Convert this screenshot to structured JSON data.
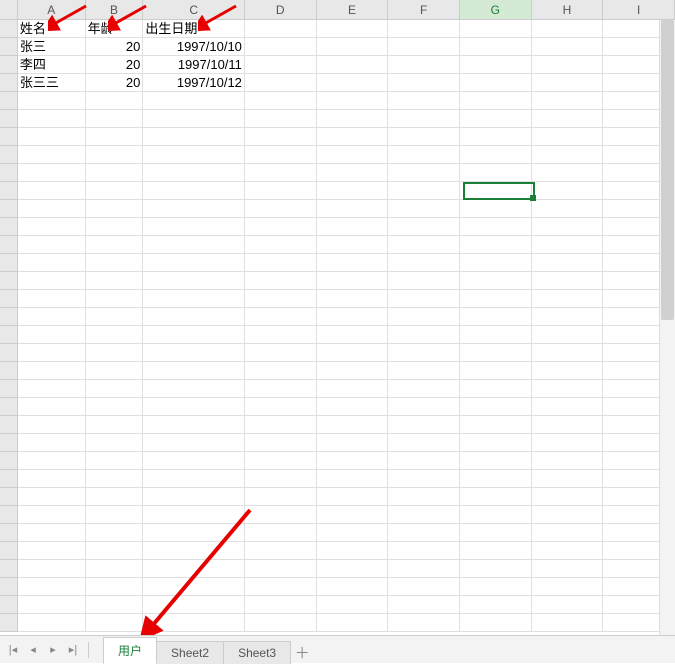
{
  "columns": [
    "A",
    "B",
    "C",
    "D",
    "E",
    "F",
    "G",
    "H",
    "I"
  ],
  "active_column": "G",
  "chart_data": {
    "type": "table",
    "headers": [
      "姓名",
      "年龄",
      "出生日期"
    ],
    "rows": [
      {
        "name": "张三",
        "age": "20",
        "dob": "1997/10/10"
      },
      {
        "name": "李四",
        "age": "20",
        "dob": "1997/10/11"
      },
      {
        "name": "张三三",
        "age": "20",
        "dob": "1997/10/12"
      }
    ]
  },
  "tabs": {
    "items": [
      "用户",
      "Sheet2",
      "Sheet3"
    ],
    "active": "用户"
  },
  "arrows": {
    "color": "#e60000"
  },
  "selection": {
    "col": "G",
    "row": 10
  },
  "total_rows": 34
}
